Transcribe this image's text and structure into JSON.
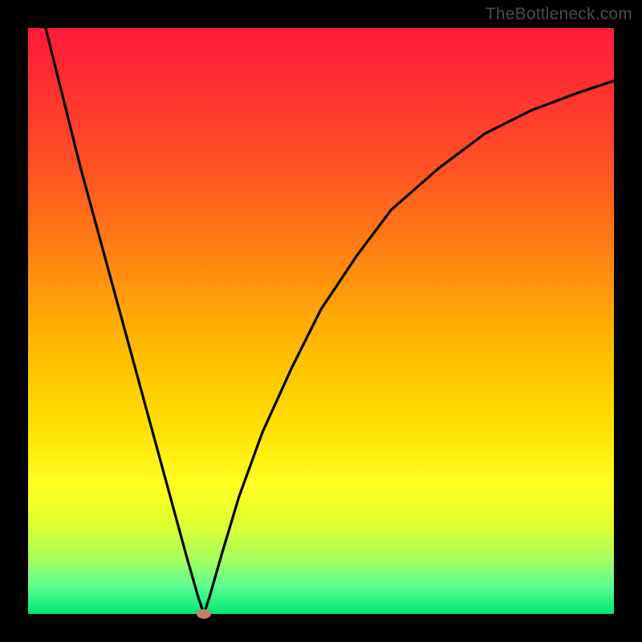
{
  "watermark": "TheBottleneck.com",
  "chart_data": {
    "type": "line",
    "title": "",
    "xlabel": "",
    "ylabel": "",
    "xlim": [
      0,
      100
    ],
    "ylim": [
      0,
      100
    ],
    "min_point": {
      "x": 30,
      "y": 0
    },
    "description": "V-shaped bottleneck curve with sharp minimum near x=30; left branch steep, right branch curved, over red-to-green vertical gradient background",
    "series": [
      {
        "name": "bottleneck-curve",
        "x": [
          3,
          6,
          9,
          12,
          15,
          18,
          21,
          24,
          27,
          29,
          30,
          31,
          33,
          36,
          40,
          45,
          50,
          56,
          62,
          70,
          78,
          86,
          94,
          100
        ],
        "y": [
          100,
          88,
          76,
          65,
          54,
          43,
          32,
          21,
          10,
          3,
          0,
          3,
          10,
          20,
          31,
          42,
          52,
          61,
          69,
          76,
          82,
          86,
          89,
          91
        ]
      }
    ],
    "marker": {
      "x": 30,
      "y": 0,
      "color": "#c97a6a"
    },
    "gradient_stops": [
      {
        "pos": 0,
        "color": "#ff1a3a"
      },
      {
        "pos": 55,
        "color": "#ffbb00"
      },
      {
        "pos": 78,
        "color": "#ffff22"
      },
      {
        "pos": 100,
        "color": "#00e676"
      }
    ]
  }
}
